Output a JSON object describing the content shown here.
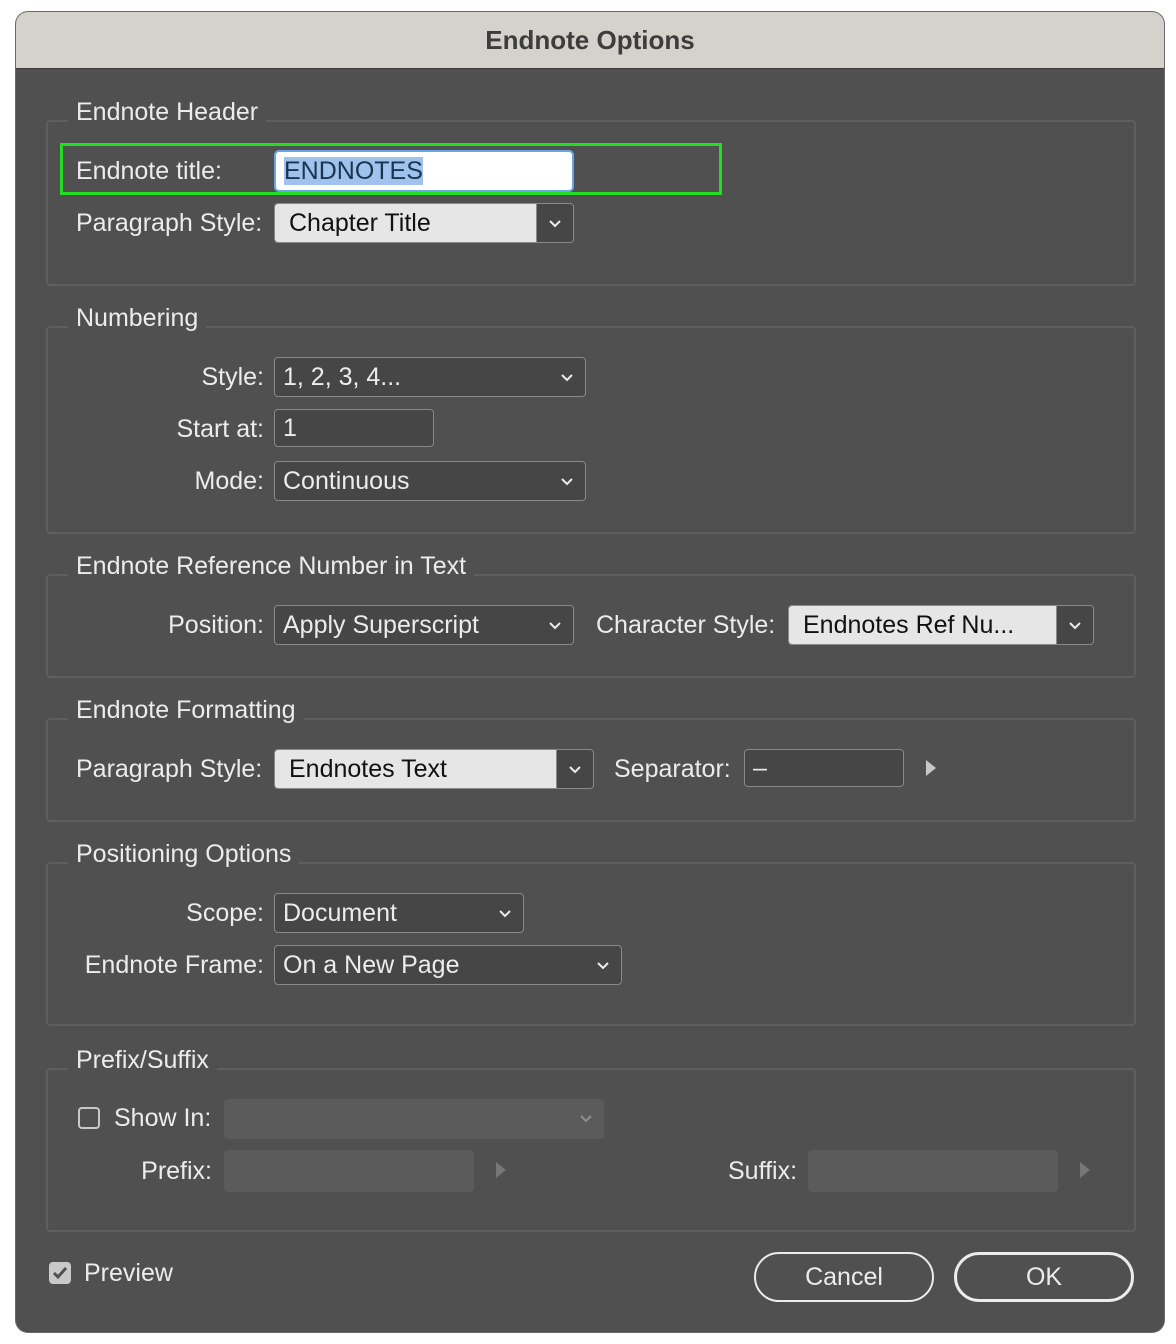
{
  "window": {
    "title": "Endnote Options"
  },
  "header": {
    "legend": "Endnote Header",
    "title_label": "Endnote title:",
    "title_value": "ENDNOTES",
    "para_style_label": "Paragraph Style:",
    "para_style_value": "Chapter Title"
  },
  "numbering": {
    "legend": "Numbering",
    "style_label": "Style:",
    "style_value": "1, 2, 3, 4...",
    "start_label": "Start at:",
    "start_value": "1",
    "mode_label": "Mode:",
    "mode_value": "Continuous"
  },
  "reference": {
    "legend": "Endnote Reference Number in Text",
    "position_label": "Position:",
    "position_value": "Apply Superscript",
    "char_style_label": "Character Style:",
    "char_style_value": "Endnotes Ref Nu..."
  },
  "formatting": {
    "legend": "Endnote Formatting",
    "para_style_label": "Paragraph Style:",
    "para_style_value": "Endnotes Text",
    "separator_label": "Separator:",
    "separator_value": "–"
  },
  "positioning": {
    "legend": "Positioning Options",
    "scope_label": "Scope:",
    "scope_value": "Document",
    "frame_label": "Endnote Frame:",
    "frame_value": "On a New Page"
  },
  "prefix_suffix": {
    "legend": "Prefix/Suffix",
    "show_in_label": "Show In:",
    "show_in_checked": false,
    "prefix_label": "Prefix:",
    "suffix_label": "Suffix:"
  },
  "footer": {
    "preview_label": "Preview",
    "preview_checked": true,
    "cancel_label": "Cancel",
    "ok_label": "OK"
  },
  "colors": {
    "dialog_bg": "#505050",
    "titlebar_bg": "#d5d1cd",
    "highlight_outline": "#22dd22",
    "selection": "#9fc3ec"
  }
}
